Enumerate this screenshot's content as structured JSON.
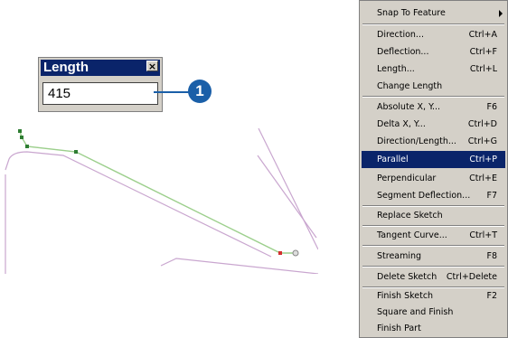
{
  "length_dialog": {
    "title": "Length",
    "close_glyph": "×",
    "value": "415"
  },
  "callout": {
    "number": "1"
  },
  "menu": {
    "items": [
      {
        "label": "Snap To Feature",
        "shortcut": "",
        "submenu": true
      },
      {
        "label": "Direction...",
        "shortcut": "Ctrl+A"
      },
      {
        "label": "Deflection...",
        "shortcut": "Ctrl+F"
      },
      {
        "label": "Length...",
        "shortcut": "Ctrl+L"
      },
      {
        "label": "Change Length",
        "shortcut": ""
      },
      {
        "label": "Absolute X, Y...",
        "shortcut": "F6"
      },
      {
        "label": "Delta X, Y...",
        "shortcut": "Ctrl+D"
      },
      {
        "label": "Direction/Length...",
        "shortcut": "Ctrl+G"
      },
      {
        "label": "Parallel",
        "shortcut": "Ctrl+P",
        "selected": true
      },
      {
        "label": "Perpendicular",
        "shortcut": "Ctrl+E"
      },
      {
        "label": "Segment Deflection...",
        "shortcut": "F7"
      },
      {
        "label": "Replace Sketch",
        "shortcut": ""
      },
      {
        "label": "Tangent Curve...",
        "shortcut": "Ctrl+T"
      },
      {
        "label": "Streaming",
        "shortcut": "F8"
      },
      {
        "label": "Delete Sketch",
        "shortcut": "Ctrl+Delete"
      },
      {
        "label": "Finish Sketch",
        "shortcut": "F2"
      },
      {
        "label": "Square and Finish",
        "shortcut": ""
      },
      {
        "label": "Finish Part",
        "shortcut": ""
      }
    ]
  },
  "colors": {
    "highlight": "#0a246a",
    "callout": "#1a5fa8",
    "sketch_line": "#9ccf8c",
    "vertex": "#2e7d32",
    "feature_line": "#c9a6cf"
  }
}
